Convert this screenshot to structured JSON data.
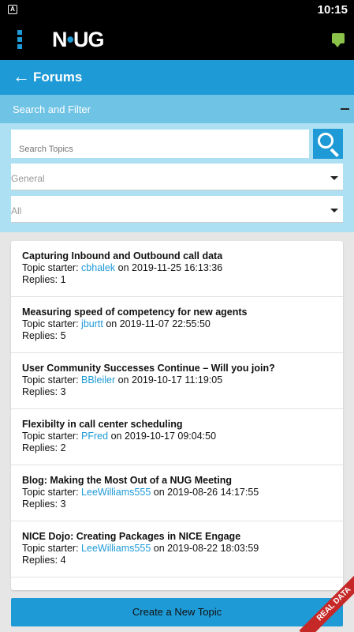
{
  "status_bar": {
    "indicator": "A",
    "time": "10:15"
  },
  "app_bar": {
    "logo_prefix": "N",
    "logo_dot": "•",
    "logo_suffix": "UG"
  },
  "title_bar": {
    "back": "←",
    "title": "Forums"
  },
  "filter": {
    "header": "Search and Filter",
    "search_placeholder": "Search Topics",
    "category": "General",
    "scope": "All"
  },
  "topics": [
    {
      "title": "Capturing Inbound and Outbound call data",
      "starter_label": "Topic starter:",
      "user": "cbhalek",
      "on": "on",
      "date": "2019-11-25 16:13:36",
      "replies_label": "Replies:",
      "replies": "1"
    },
    {
      "title": "Measuring speed of competency for new agents",
      "starter_label": "Topic starter:",
      "user": "jburtt",
      "on": "on",
      "date": "2019-11-07 22:55:50",
      "replies_label": "Replies:",
      "replies": "5"
    },
    {
      "title": "User Community Successes Continue – Will you join?",
      "starter_label": "Topic starter:",
      "user": "BBleiler",
      "on": "on",
      "date": "2019-10-17 11:19:05",
      "replies_label": "Replies:",
      "replies": "3"
    },
    {
      "title": "Flexibilty in call center scheduling",
      "starter_label": "Topic starter:",
      "user": "PFred",
      "on": "on",
      "date": "2019-10-17 09:04:50",
      "replies_label": "Replies:",
      "replies": "2"
    },
    {
      "title": "Blog: Making the Most Out of a NUG Meeting",
      "starter_label": "Topic starter:",
      "user": "LeeWilliams555",
      "on": "on",
      "date": "2019-08-26 14:17:55",
      "replies_label": "Replies:",
      "replies": "3"
    },
    {
      "title": "NICE Dojo: Creating Packages in NICE Engage",
      "starter_label": "Topic starter:",
      "user": "LeeWilliams555",
      "on": "on",
      "date": "2019-08-22 18:03:59",
      "replies_label": "Replies:",
      "replies": "4"
    }
  ],
  "create_button": "Create a New Topic",
  "ribbon": "REAL DATA",
  "colors": {
    "primary": "#1e9ad6",
    "filter_header": "#6fc3e4",
    "filter_panel": "#ade0f2",
    "chat": "#8bc34a",
    "ribbon": "#c62828"
  }
}
